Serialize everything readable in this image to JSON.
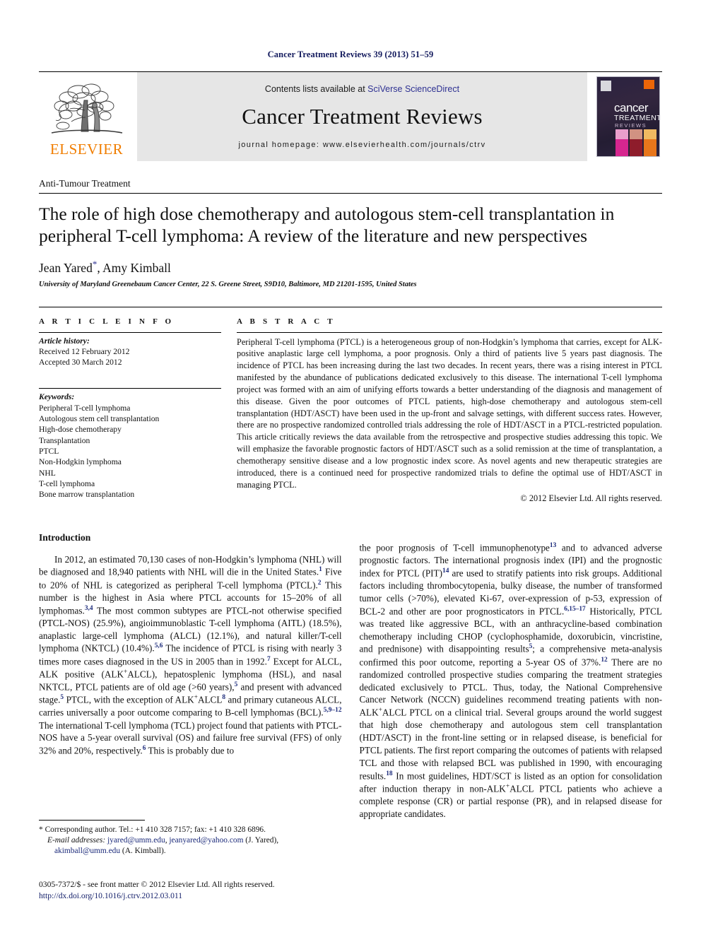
{
  "running_head": "Cancer Treatment Reviews 39 (2013) 51–59",
  "masthead": {
    "publisher_name": "ELSEVIER",
    "contents_prefix": "Contents lists available at ",
    "contents_link": "SciVerse ScienceDirect",
    "journal_title": "Cancer Treatment Reviews",
    "homepage": "journal homepage: www.elsevierhealth.com/journals/ctrv",
    "cover": {
      "line1": "cancer",
      "line2": "TREATMENT",
      "line3": "REVIEWS"
    }
  },
  "article": {
    "section_label": "Anti-Tumour Treatment",
    "title": "The role of high dose chemotherapy and autologous stem-cell transplantation in peripheral T-cell lymphoma: A review of the literature and new perspectives",
    "authors": "Jean Yared",
    "corresponding_marker": "*",
    "authors_rest": ", Amy Kimball",
    "affiliation": "University of Maryland Greenebaum Cancer Center, 22 S. Greene Street, S9D10, Baltimore, MD 21201-1595, United States"
  },
  "article_info": {
    "heading": "A R T I C L E  I N F O",
    "history_label": "Article history:",
    "received": "Received 12 February 2012",
    "accepted": "Accepted 30 March 2012",
    "keywords_label": "Keywords:",
    "keywords": [
      "Peripheral T-cell lymphoma",
      "Autologous stem cell transplantation",
      "High-dose chemotherapy",
      "Transplantation",
      "PTCL",
      "Non-Hodgkin lymphoma",
      "NHL",
      "T-cell lymphoma",
      "Bone marrow transplantation"
    ]
  },
  "abstract": {
    "heading": "A B S T R A C T",
    "text": "Peripheral T-cell lymphoma (PTCL) is a heterogeneous group of non-Hodgkin’s lymphoma that carries, except for ALK-positive anaplastic large cell lymphoma, a poor prognosis. Only a third of patients live 5 years past diagnosis. The incidence of PTCL has been increasing during the last two decades. In recent years, there was a rising interest in PTCL manifested by the abundance of publications dedicated exclusively to this disease. The international T-cell lymphoma project was formed with an aim of unifying efforts towards a better understanding of the diagnosis and management of this disease. Given the poor outcomes of PTCL patients, high-dose chemotherapy and autologous stem-cell transplantation (HDT/ASCT) have been used in the up-front and salvage settings, with different success rates. However, there are no prospective randomized controlled trials addressing the role of HDT/ASCT in a PTCL-restricted population. This article critically reviews the data available from the retrospective and prospective studies addressing this topic. We will emphasize the favorable prognostic factors of HDT/ASCT such as a solid remission at the time of transplantation, a chemotherapy sensitive disease and a low prognostic index score. As novel agents and new therapeutic strategies are introduced, there is a continued need for prospective randomized trials to define the optimal use of HDT/ASCT in managing PTCL.",
    "copyright": "© 2012 Elsevier Ltd. All rights reserved."
  },
  "body": {
    "intro_heading": "Introduction",
    "left_paragraph_parts": {
      "p1": "In 2012, an estimated 70,130 cases of non-Hodgkin’s lymphoma (NHL) will be diagnosed and 18,940 patients with NHL will die in the United States.",
      "r1": "1",
      "p2": " Five to 20% of NHL is categorized as peripheral T-cell lymphoma (PTCL).",
      "r2": "2",
      "p3": " This number is the highest in Asia where PTCL accounts for 15–20% of all lymphomas.",
      "r3": "3,4",
      "p4": " The most common subtypes are PTCL-not otherwise specified (PTCL-NOS) (25.9%), angioimmunoblastic T-cell lymphoma (AITL) (18.5%), anaplastic large-cell lymphoma (ALCL) (12.1%), and natural killer/T-cell lymphoma (NKTCL) (10.4%).",
      "r4": "5,6",
      "p5": " The incidence of PTCL is rising with nearly 3 times more cases diagnosed in the US in 2005 than in 1992.",
      "r5": "7",
      "p6": " Except for ALCL, ALK positive (ALK",
      "sup_plus_a": "+",
      "p7": "ALCL), hepatosplenic lymphoma (HSL), and nasal NKTCL, PTCL patients are of old age (>60 years),",
      "r6": "5",
      "p8": " and present with advanced stage.",
      "r7": "5",
      "p9": " PTCL, with the exception of ALK",
      "sup_plus_b": "+",
      "p10": "ALCL",
      "r8": "8",
      "p11": " and primary cutaneous ALCL, carries universally a poor outcome comparing to B-cell lymphomas (BCL).",
      "r9": "5,9–12",
      "p12": " The international T-cell lymphoma (TCL) project found that patients with PTCL-NOS have a 5-year overall survival (OS) and failure free survival (FFS) of only 32% and 20%, respectively.",
      "r10": "6",
      "p13": " This is probably due to"
    },
    "right_paragraph_parts": {
      "p1": "the poor prognosis of T-cell immunophenotype",
      "r1": "13",
      "p2": " and to advanced adverse prognostic factors. The international prognosis index (IPI) and the prognostic index for PTCL (PIT)",
      "r2": "14",
      "p3": " are used to stratify patients into risk groups. Additional factors including thrombocytopenia, bulky disease, the number of transformed tumor cells (>70%), elevated Ki-67, over-expression of p-53, expression of BCL-2 and other are poor prognosticators in PTCL.",
      "r3": "6,15–17",
      "p4": " Historically, PTCL was treated like aggressive BCL, with an anthracycline-based combination chemotherapy including CHOP (cyclophosphamide, doxorubicin, vincristine, and prednisone) with disappointing results",
      "r4": "5",
      "p5": "; a comprehensive meta-analysis confirmed this poor outcome, reporting a 5-year OS of 37%.",
      "r5": "12",
      "p6": " There are no randomized controlled prospective studies comparing the treatment strategies dedicated exclusively to PTCL. Thus, today, the National Comprehensive Cancer Network (NCCN) guidelines recommend treating patients with non-ALK",
      "sup_plus_a": "+",
      "p7": "ALCL PTCL on a clinical trial. Several groups around the world suggest that high dose chemotherapy and autologous stem cell transplantation (HDT/ASCT) in the front-line setting or in relapsed disease, is beneficial for PTCL patients. The first report comparing the outcomes of patients with relapsed TCL and those with relapsed BCL was published in 1990, with encouraging results.",
      "r6": "18",
      "p8": " In most guidelines, HDT/SCT is listed as an option for consolidation after induction therapy in non-ALK",
      "sup_plus_b": "+",
      "p9": "ALCL PTCL patients who achieve a complete response (CR) or partial response (PR), and in relapsed disease for appropriate candidates."
    }
  },
  "footnote": {
    "marker": "*",
    "corresponding": "Corresponding author. Tel.: +1 410 328 7157; fax: +1 410 328 6896.",
    "email_label": "E-mail addresses:",
    "email1": "jyared@umm.edu",
    "email_sep1": ", ",
    "email2": "jeanyared@yahoo.com",
    "email_name1": " (J. Yared), ",
    "email3": "akimball@umm.edu",
    "email_name2": " (A. Kimball)."
  },
  "imprint": {
    "line1": "0305-7372/$ - see front matter © 2012 Elsevier Ltd. All rights reserved.",
    "doi": "http://dx.doi.org/10.1016/j.ctrv.2012.03.011"
  },
  "colors": {
    "link_blue": "#2e3192",
    "ref_blue": "#1b2a7a",
    "elsevier_orange": "#f07d00",
    "header_gray": "#e6e6e6",
    "running_head_navy": "#141b5e"
  }
}
